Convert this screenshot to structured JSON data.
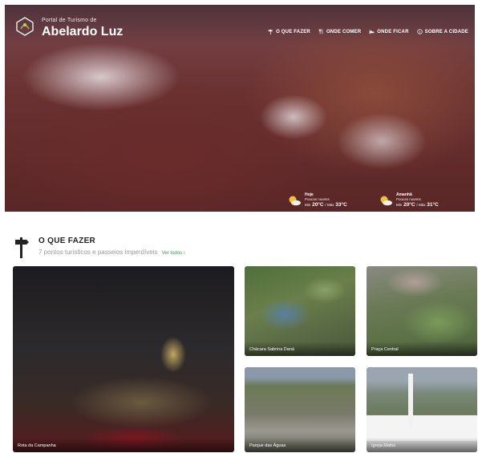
{
  "header": {
    "brand_small": "Portal de Turismo de",
    "brand_big": "Abelardo Luz",
    "nav": [
      {
        "label": "O QUE FAZER",
        "icon": "signpost-icon"
      },
      {
        "label": "ONDE COMER",
        "icon": "cutlery-icon"
      },
      {
        "label": "ONDE FICAR",
        "icon": "bed-icon"
      },
      {
        "label": "SOBRE A CIDADE",
        "icon": "info-icon"
      }
    ]
  },
  "weather": [
    {
      "day": "Hoje",
      "desc": "Poucas nuvens",
      "min_label": "Min",
      "min": "20°C",
      "max_label": "Máx",
      "max": "33°C",
      "icon": "partly-cloudy-icon"
    },
    {
      "day": "Amanhã",
      "desc": "Poucas nuvens",
      "min_label": "Min",
      "min": "20°C",
      "max_label": "Máx",
      "max": "31°C",
      "icon": "partly-cloudy-icon"
    }
  ],
  "section": {
    "title": "O QUE FAZER",
    "subtitle": "7 pontos turísticos e passeios imperdíveis",
    "link": "Ver todos ›",
    "icon": "signpost-icon"
  },
  "cards": [
    {
      "caption": "Rota da Campanha"
    },
    {
      "caption": "Chácara Sabrina Daná"
    },
    {
      "caption": "Praça Central"
    },
    {
      "caption": "Parque das Águas"
    },
    {
      "caption": "Igreja Matriz"
    }
  ],
  "colors": {
    "accent_green": "#3a9a56",
    "sun": "#f2c12e"
  }
}
